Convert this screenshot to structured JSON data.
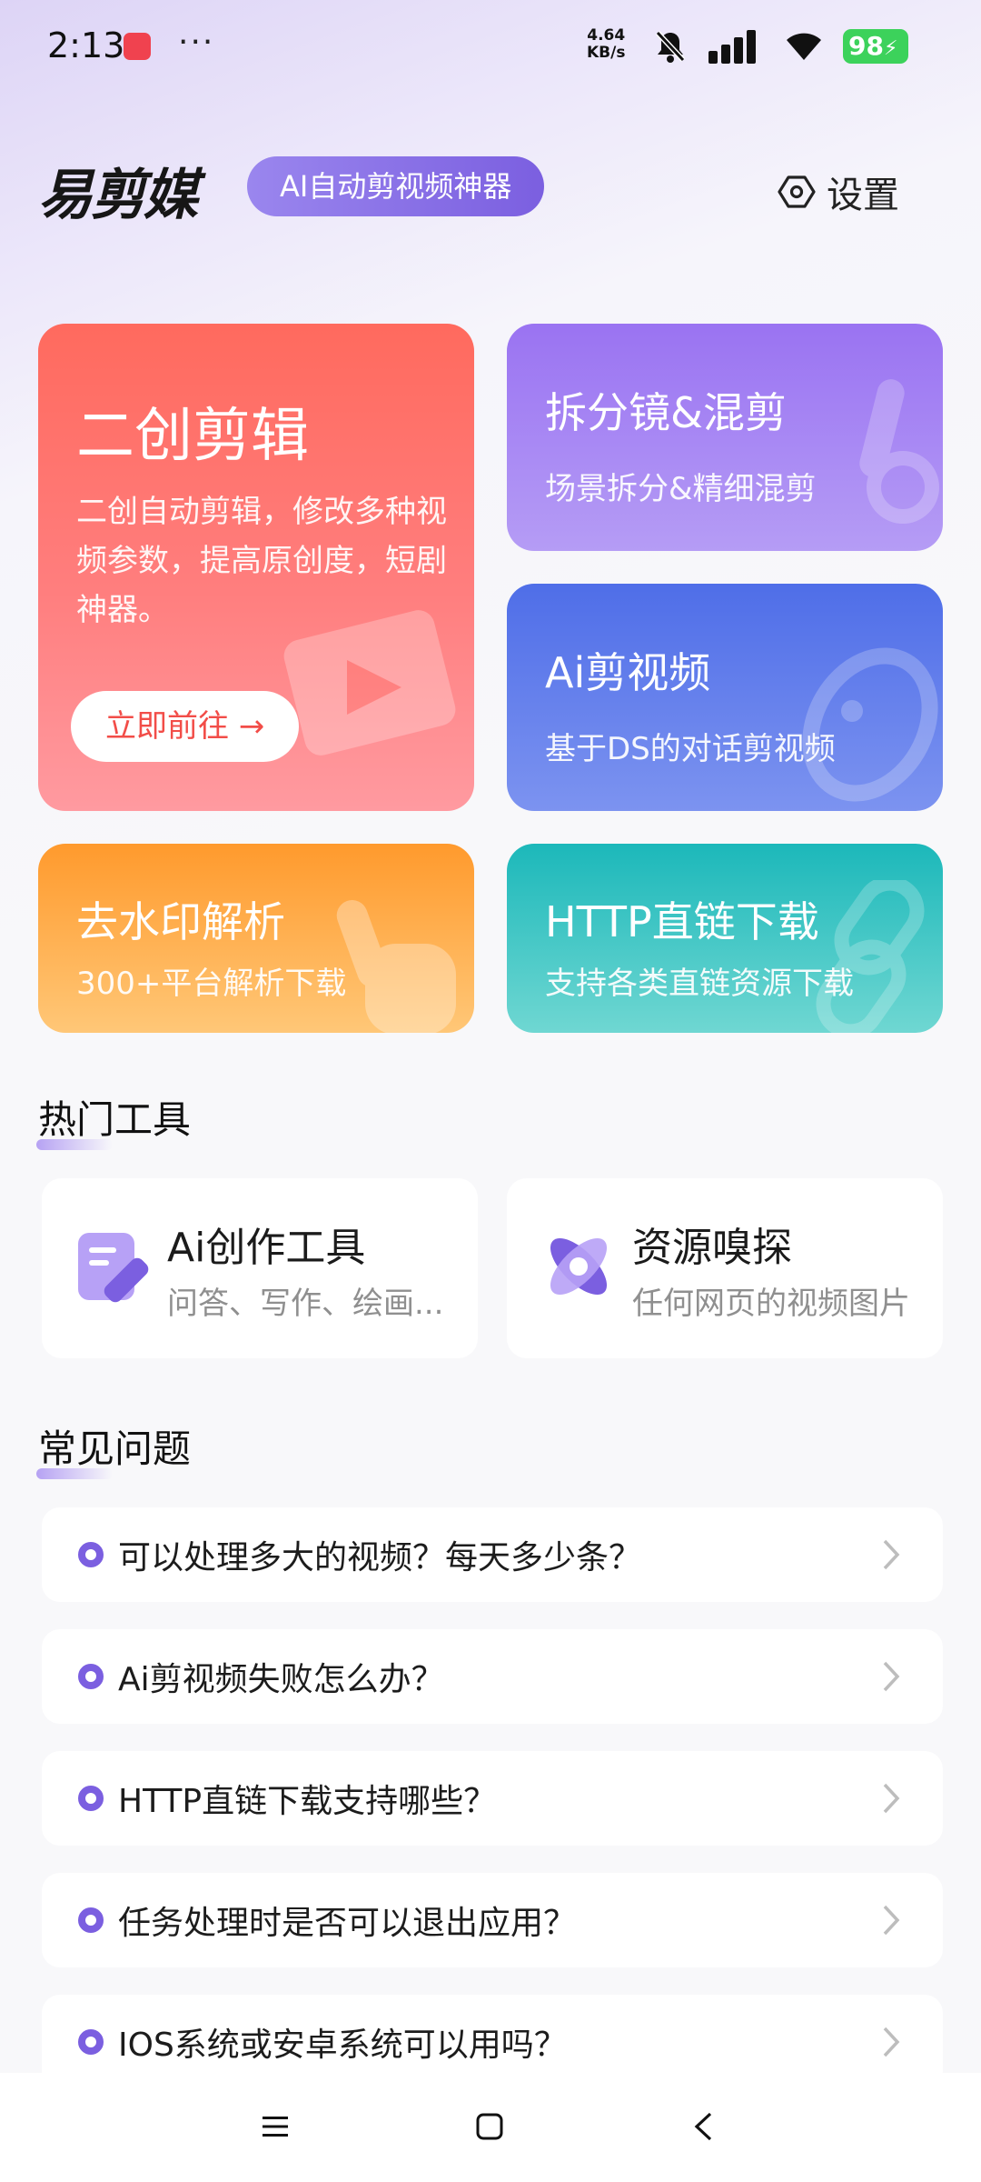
{
  "status_bar": {
    "time": "2:13",
    "more": "···",
    "speed": "4.64",
    "speed_unit": "KB/s",
    "battery": "98"
  },
  "header": {
    "logo": "易剪媒",
    "tagline": "AI自动剪视频神器",
    "settings_label": "设置"
  },
  "cards": {
    "main": {
      "title": "二创剪辑",
      "desc": "二创自动剪辑，修改多种视频参数，提高原创度，短剧神器。",
      "button": "立即前往 →"
    },
    "split": {
      "title": "拆分镜&混剪",
      "desc": "场景拆分&精细混剪"
    },
    "ai": {
      "title": "Ai剪视频",
      "desc": "基于DS的对话剪视频"
    },
    "watermark": {
      "title": "去水印解析",
      "desc": "300+平台解析下载"
    },
    "http": {
      "title": "HTTP直链下载",
      "desc": "支持各类直链资源下载"
    }
  },
  "hot_tools": {
    "title": "热门工具",
    "items": [
      {
        "title": "Ai创作工具",
        "desc": "问答、写作、绘画...",
        "icon": "edit-note-icon"
      },
      {
        "title": "资源嗅探",
        "desc": "任何网页的视频图片",
        "icon": "atom-sniff-icon"
      }
    ]
  },
  "faq": {
    "title": "常见问题",
    "items": [
      "可以处理多大的视频？每天多少条？",
      "Ai剪视频失败怎么办？",
      "HTTP直链下载支持哪些？",
      "任务处理时是否可以退出应用？",
      "IOS系统或安卓系统可以用吗？"
    ]
  },
  "colors": {
    "accent": "#7b5fe0",
    "main_card": "#ff6a5e",
    "split_card": "#9a73f2",
    "ai_card": "#4f6ee8",
    "watermark_card": "#ff9a2d",
    "http_card": "#1cb8ba"
  }
}
